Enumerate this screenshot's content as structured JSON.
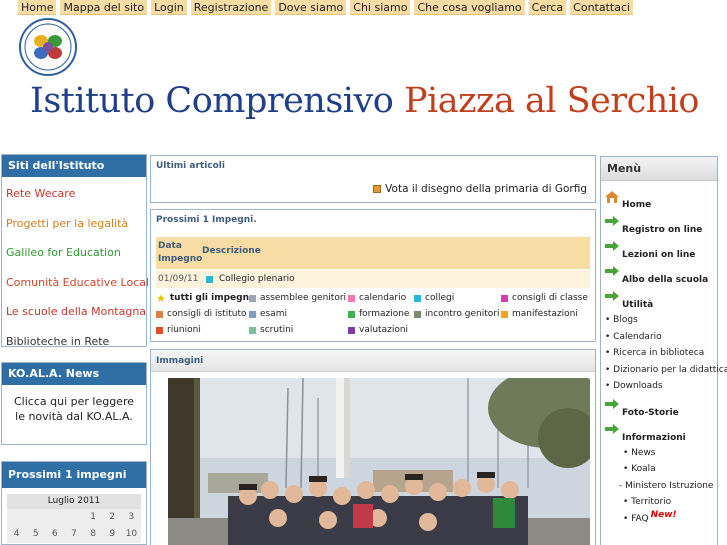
{
  "nav": [
    "Home",
    "Mappa del sito",
    "Login",
    "Registrazione",
    "Dove siamo",
    "Chi siamo",
    "Che cosa vogliamo",
    "Cerca",
    "Contattaci"
  ],
  "header": {
    "title_part1": "Istituto Comprensivo",
    "title_part2": "Piazza al Serchio",
    "title_color1": "#1f3f8a",
    "title_color2": "#c23f1c"
  },
  "siti": {
    "title": "Siti dell'Istituto",
    "items": [
      {
        "label": "Rete Wecare",
        "color": "#c0392b"
      },
      {
        "label": "Progetti per la legalità",
        "color": "#d67c1c"
      },
      {
        "label": "Galileo for Education",
        "color": "#2e9a2e"
      },
      {
        "label": "Comunità Educative Locali",
        "color": "#d0452b"
      },
      {
        "label": "Le scuole della Montagna",
        "color": "#c0392b"
      },
      {
        "label": "Biblioteche in Rete",
        "color": "#333333"
      }
    ]
  },
  "koala": {
    "title": "KO.AL.A. News",
    "text": "Clicca qui per leggere le novità dal KO.AL.A."
  },
  "calendar": {
    "title": "Prossimi 1 impegni",
    "month": "Luglio 2011",
    "rows": [
      [
        "",
        "",
        "",
        "",
        "1",
        "2",
        "3"
      ],
      [
        "4",
        "5",
        "6",
        "7",
        "8",
        "9",
        "10"
      ]
    ]
  },
  "articoli": {
    "title": "Ultimi articoli",
    "item": "Vota il disegno della primaria di Gorfig",
    "item_color": "#e59a2f"
  },
  "impegni": {
    "title": "Prossimi 1 Impegni.",
    "col_date_line1": "Data",
    "col_date_line2": "Impegno",
    "col_desc": "Descrizione",
    "event_date": "01/09/11",
    "event_desc": "Collegio plenario",
    "categories": [
      {
        "label": "tutti gli impegni",
        "icon": "star-icon",
        "color": "#e8c300"
      },
      {
        "label": "assemblee genitori",
        "icon": "square-icon",
        "color": "#9aa6b2"
      },
      {
        "label": "calendario",
        "icon": "square-icon",
        "color": "#f07ab0"
      },
      {
        "label": "collegi",
        "icon": "square-icon",
        "color": "#2ab5d9"
      },
      {
        "label": "consigli di classe",
        "icon": "square-icon",
        "color": "#d43eb0"
      },
      {
        "label": "consigli di istituto",
        "icon": "square-icon",
        "color": "#d9824a"
      },
      {
        "label": "esami",
        "icon": "square-icon",
        "color": "#7f9cc4"
      },
      {
        "label": "formazione",
        "icon": "square-icon",
        "color": "#3fb34a"
      },
      {
        "label": "incontro genitori",
        "icon": "square-icon",
        "color": "#7f8b6e"
      },
      {
        "label": "manifestazioni",
        "icon": "square-icon",
        "color": "#f0a31c"
      },
      {
        "label": "riunioni",
        "icon": "square-icon",
        "color": "#e0502a"
      },
      {
        "label": "scrutini",
        "icon": "square-icon",
        "color": "#7fc09a"
      },
      {
        "label": "valutazioni",
        "icon": "square-icon",
        "color": "#7a3fa0"
      }
    ]
  },
  "immagini": {
    "title": "Immagini"
  },
  "menu": {
    "title": "Menù",
    "items": [
      {
        "type": "head",
        "label": "Home",
        "icon": "home-icon"
      },
      {
        "type": "head",
        "label": "Registro on line",
        "icon": "arrow-right-icon"
      },
      {
        "type": "head",
        "label": "Lezioni on line",
        "icon": "arrow-right-icon"
      },
      {
        "type": "head",
        "label": "Albo della scuola",
        "icon": "arrow-right-icon"
      },
      {
        "type": "head",
        "label": "Utilità",
        "icon": "arrow-right-icon"
      },
      {
        "type": "sub",
        "label": "Blogs"
      },
      {
        "type": "sub",
        "label": "Calendario"
      },
      {
        "type": "sub",
        "label": "Ricerca in biblioteca"
      },
      {
        "type": "sub",
        "label": "Dizionario per la didattica"
      },
      {
        "type": "sub",
        "label": "Downloads"
      },
      {
        "type": "head",
        "label": "Foto-Storie",
        "icon": "arrow-right-icon"
      },
      {
        "type": "head",
        "label": "Informazioni",
        "icon": "arrow-right-icon"
      },
      {
        "type": "sub2",
        "label": "News"
      },
      {
        "type": "sub2",
        "label": "Koala"
      },
      {
        "type": "sub3",
        "label": "- Ministero Istruzione"
      },
      {
        "type": "sub2",
        "label": "Territorio"
      },
      {
        "type": "sub2",
        "label": "FAQ",
        "badge": "New!"
      }
    ]
  }
}
